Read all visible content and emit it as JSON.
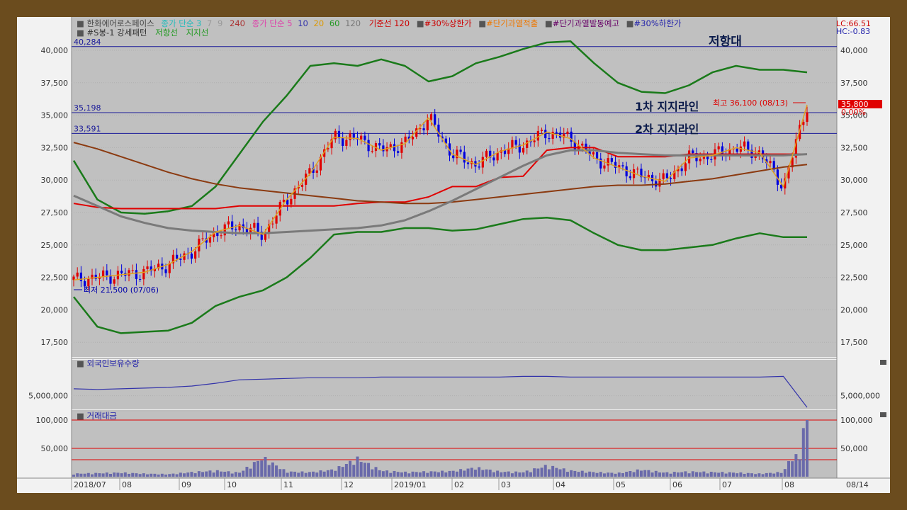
{
  "legend": {
    "stock_name": "한화에어로스페이스",
    "ma_label": "종가 단순 3",
    "ma_periods": [
      "7",
      "9",
      "240"
    ],
    "vol_ma_label": "종가 단순 5",
    "vol_ma_periods": [
      "10",
      "20",
      "60",
      "120"
    ],
    "kijun_label": "기준선 120",
    "upper_limit": "#30%상한가",
    "overheat": "#단기과열적출",
    "overheat_warn": "#단기과열발동예고",
    "lower_limit": "#30%하한가",
    "pattern": "#S봉-1 강세패턴",
    "resistance_label": "저항선",
    "support_label": "지지선"
  },
  "corner": {
    "lc": "LC:66.51",
    "hc": "HC:-0.83"
  },
  "annotations": {
    "resistance_zone": "저항대",
    "support_1": "1차 지지라인",
    "support_2": "2차 지지라인",
    "high_label": "최고 36,100 (08/13)",
    "low_label": "최저 21,500 (07/06)",
    "current_price": "35,800",
    "current_change": "0.00%"
  },
  "colors": {
    "frame": "#6b4c1e",
    "plot_bg": "#c0c0c0",
    "bollinger": "#1a7a1a",
    "kijun": "#e00000",
    "ma240": "#8b3a10",
    "ma120": "#7a7a7a",
    "hline": "#1a1a99",
    "up": "#e00000",
    "down": "#0000dd"
  },
  "chart_data": [
    {
      "type": "line",
      "title": "",
      "ylim": [
        16500,
        42000
      ],
      "y_ticks": [
        "40,000",
        "37,500",
        "35,000",
        "32,500",
        "30,000",
        "27,500",
        "25,000",
        "22,500",
        "20,000",
        "17,500"
      ],
      "x_ticks": [
        "2018/07",
        "08",
        "09",
        "10",
        "11",
        "12",
        "2019/01",
        "02",
        "03",
        "04",
        "05",
        "06",
        "07",
        "08",
        "08/14"
      ],
      "horizontal_lines": [
        {
          "label": "40,284",
          "value": 40284
        },
        {
          "label": "35,198",
          "value": 35198
        },
        {
          "label": "33,591",
          "value": 33591
        }
      ],
      "series": [
        {
          "name": "",
          "style": "bollinger-upper",
          "values": [
            31500,
            28500,
            27500,
            27400,
            27600,
            28000,
            29500,
            32000,
            34500,
            36500,
            38800,
            39000,
            38800,
            39300,
            38800,
            37600,
            38000,
            39000,
            39500,
            40100,
            40600,
            40700,
            39000,
            37500,
            36800,
            36700,
            37300,
            38300,
            38800,
            38500,
            38500,
            38300
          ]
        },
        {
          "name": "",
          "style": "bollinger-lower",
          "values": [
            21000,
            18700,
            18200,
            18300,
            18400,
            19000,
            20300,
            21000,
            21500,
            22500,
            24000,
            25800,
            26000,
            26000,
            26300,
            26300,
            26100,
            26200,
            26600,
            27000,
            27100,
            26900,
            25900,
            25000,
            24600,
            24600,
            24800,
            25000,
            25500,
            25900,
            25600,
            25600
          ]
        },
        {
          "name": "",
          "style": "kijun",
          "values": [
            28200,
            27900,
            27800,
            27800,
            27800,
            27800,
            27800,
            28000,
            28000,
            28000,
            28000,
            28000,
            28200,
            28300,
            28300,
            28700,
            29500,
            29500,
            30200,
            30300,
            32300,
            32500,
            32500,
            31800,
            31800,
            31800,
            32000,
            32000,
            32000,
            32000,
            32000,
            32000
          ]
        },
        {
          "name": "",
          "style": "ma240",
          "values": [
            32900,
            32400,
            31800,
            31200,
            30600,
            30100,
            29700,
            29400,
            29200,
            29000,
            28800,
            28600,
            28400,
            28300,
            28200,
            28200,
            28300,
            28500,
            28700,
            28900,
            29100,
            29300,
            29500,
            29600,
            29600,
            29700,
            29900,
            30100,
            30400,
            30700,
            31000,
            31200
          ]
        },
        {
          "name": "",
          "style": "ma120",
          "values": [
            28800,
            28000,
            27200,
            26700,
            26300,
            26100,
            26000,
            25900,
            25900,
            26000,
            26100,
            26200,
            26300,
            26500,
            26900,
            27600,
            28400,
            29300,
            30200,
            31100,
            31900,
            32300,
            32300,
            32100,
            32000,
            31900,
            31900,
            31900,
            31900,
            31900,
            31900,
            32000
          ]
        },
        {
          "name": "",
          "style": "close",
          "values": [
            22300,
            22500,
            22700,
            22900,
            23500,
            24500,
            26000,
            26500,
            25800,
            28500,
            30500,
            33300,
            33200,
            32300,
            32800,
            34800,
            32000,
            31200,
            32200,
            32700,
            33700,
            33200,
            31700,
            31000,
            30300,
            29900,
            31700,
            31900,
            32500,
            32100,
            29500,
            35800
          ]
        }
      ]
    },
    {
      "type": "line",
      "title": "외국인보유수량",
      "ylim": [
        4000000,
        7500000
      ],
      "y_ticks": [
        "5,000,000"
      ],
      "series": [
        {
          "name": "외국인보유수량",
          "values": [
            5500000,
            5450000,
            5500000,
            5550000,
            5600000,
            5700000,
            5900000,
            6150000,
            6200000,
            6250000,
            6300000,
            6300000,
            6300000,
            6350000,
            6350000,
            6350000,
            6350000,
            6350000,
            6350000,
            6400000,
            6400000,
            6350000,
            6350000,
            6350000,
            6350000,
            6350000,
            6350000,
            6350000,
            6350000,
            6350000,
            6400000,
            4150000
          ]
        }
      ]
    },
    {
      "type": "bar",
      "title": "거래대금",
      "ylim": [
        0,
        110000
      ],
      "y_ticks": [
        "100,000",
        "50,000"
      ],
      "reference_lines": [
        100000,
        50000,
        30000
      ],
      "values": [
        6000,
        7000,
        8000,
        6000,
        5000,
        9000,
        12000,
        8000,
        38000,
        10000,
        9000,
        14000,
        36000,
        12000,
        9000,
        10000,
        11000,
        18000,
        10000,
        9000,
        22000,
        12000,
        9000,
        7000,
        14000,
        8000,
        10000,
        9000,
        8000,
        6000,
        9000,
        100000
      ]
    }
  ]
}
